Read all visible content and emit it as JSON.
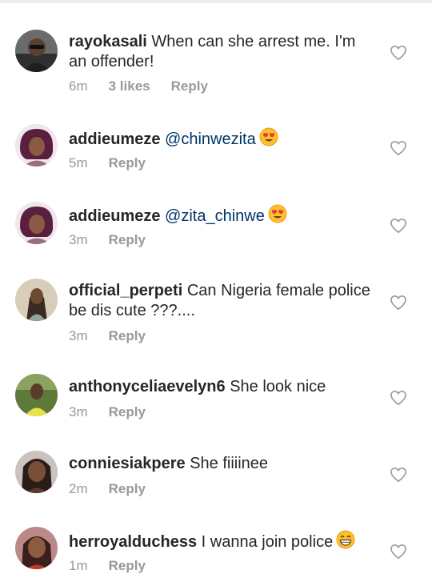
{
  "comments": [
    {
      "username": "rayokasali",
      "text": "When can she arrest me. I'm an offender!",
      "text_line1": "When can she arrest me. I'm",
      "text_line2": "an offender!",
      "time": "6m",
      "likes": "3 likes",
      "reply": "Reply"
    },
    {
      "username": "addieumeze",
      "mention": "@chinwezita",
      "emoji": "heart-eyes-emoji",
      "time": "5m",
      "reply": "Reply"
    },
    {
      "username": "addieumeze",
      "mention": "@zita_chinwe",
      "emoji": "heart-eyes-emoji",
      "time": "3m",
      "reply": "Reply"
    },
    {
      "username": "official_perpeti",
      "text": "Can Nigeria female police be dis cute ???....",
      "text_line1": "Can Nigeria female police",
      "text_line2": "be dis cute ???....",
      "time": "3m",
      "reply": "Reply"
    },
    {
      "username": "anthonyceliaevelyn6",
      "text": "She look nice",
      "time": "3m",
      "reply": "Reply"
    },
    {
      "username": "conniesiakpere",
      "text": "She fiiiinee",
      "time": "2m",
      "reply": "Reply"
    },
    {
      "username": "herroyalduchess",
      "text": "I wanna join police",
      "emoji": "grinning-emoji",
      "time": "1m",
      "reply": "Reply"
    }
  ],
  "icons": {
    "like": "heart-outline-icon"
  },
  "colors": {
    "text": "#262626",
    "meta": "#999999",
    "mention": "#003569"
  }
}
